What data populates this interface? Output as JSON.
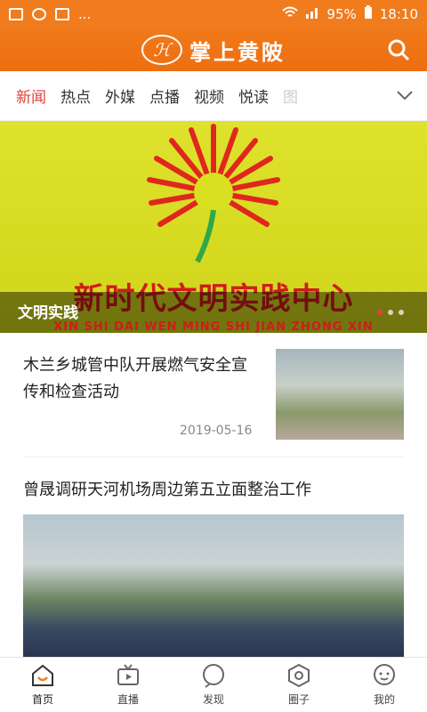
{
  "status": {
    "carrier_dots": "...",
    "battery": "95%",
    "time": "18:10"
  },
  "header": {
    "logo_text": "掌上黄陂"
  },
  "tabs": [
    {
      "label": "新闻"
    },
    {
      "label": "热点"
    },
    {
      "label": "外媒"
    },
    {
      "label": "点播"
    },
    {
      "label": "视频"
    },
    {
      "label": "悦读"
    },
    {
      "label": "图"
    }
  ],
  "banner": {
    "headline": "新时代文明实践中心",
    "pinyin": "XIN SHI DAI WEN MING SHI JIAN ZHONG XIN",
    "caption": "文明实践"
  },
  "news": [
    {
      "title": "木兰乡城管中队开展燃气安全宣传和检查活动",
      "date": "2019-05-16"
    },
    {
      "title": "曾晟调研天河机场周边第五立面整治工作"
    }
  ],
  "bottom_nav": [
    {
      "label": "首页"
    },
    {
      "label": "直播"
    },
    {
      "label": "发现"
    },
    {
      "label": "圈子"
    },
    {
      "label": "我的"
    }
  ],
  "colors": {
    "brand": "#f07c1e",
    "active": "#e2423a"
  }
}
